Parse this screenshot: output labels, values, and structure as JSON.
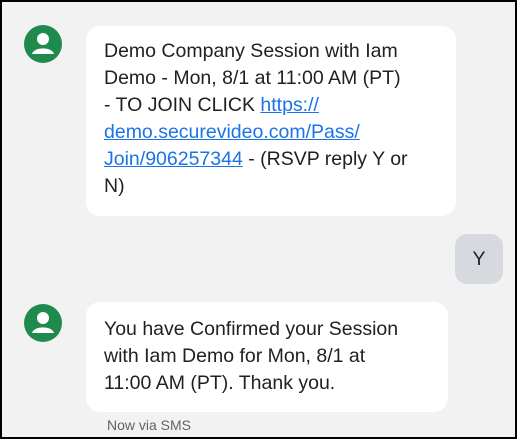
{
  "conversation": {
    "brand_color": "#1f8a4e",
    "link_color": "#1a73e8",
    "messages": [
      {
        "sender_icon": "person-avatar-icon",
        "lines": [
          "Demo Company Session with Iam",
          "Demo - Mon, 8/1 at 11:00 AM (PT)"
        ],
        "line3_prefix": "- TO JOIN CLICK ",
        "link_part1": "https://",
        "link_part2": "demo.securevideo.com/Pass/",
        "link_part3": "Join/906257344",
        "suffix_after_link": " - (RSVP reply Y or",
        "line_last": "N)"
      },
      {
        "text": "Y"
      },
      {
        "sender_icon": "person-avatar-icon",
        "lines": [
          "You have Confirmed your Session",
          "with Iam Demo for Mon, 8/1 at",
          "11:00 AM (PT). Thank you."
        ],
        "meta": "Now via SMS"
      }
    ]
  }
}
